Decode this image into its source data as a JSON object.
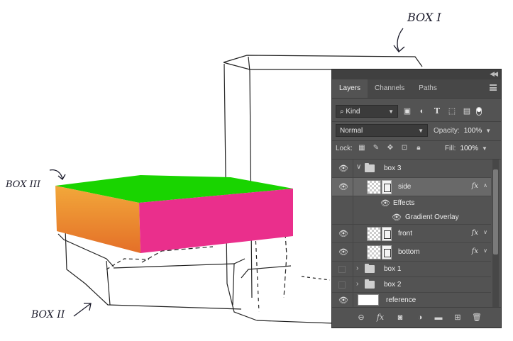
{
  "sketch": {
    "label_box_i": "BOX I",
    "label_box_ii": "BOX II",
    "label_box_iii": "BOX III",
    "colors": {
      "top": "#19d300",
      "left_top": "#f2a436",
      "left_bottom": "#e2702a",
      "front": "#ec2f8c"
    }
  },
  "panel": {
    "tabs": [
      {
        "label": "Layers",
        "active": true
      },
      {
        "label": "Channels"
      },
      {
        "label": "Paths"
      }
    ],
    "filter": {
      "kind_label": "Kind",
      "icons": [
        "image-filter-icon",
        "adjustment-filter-icon",
        "type-filter-icon",
        "shape-filter-icon",
        "smart-object-filter-icon"
      ]
    },
    "blend_mode": "Normal",
    "opacity_label": "Opacity:",
    "opacity_value": "100%",
    "lock_label": "Lock:",
    "fill_label": "Fill:",
    "fill_value": "100%",
    "layers": [
      {
        "name": "box 3",
        "type": "group",
        "expanded": true,
        "visible": true
      },
      {
        "name": "side",
        "type": "layer",
        "selected": true,
        "fx": "fx",
        "visible": true
      },
      {
        "name": "Effects",
        "type": "effects-header",
        "visible": true
      },
      {
        "name": "Gradient Overlay",
        "type": "effect",
        "visible": true
      },
      {
        "name": "front",
        "type": "layer",
        "fx": "fx",
        "visible": true
      },
      {
        "name": "bottom",
        "type": "layer",
        "fx": "fx",
        "visible": true
      },
      {
        "name": "box 1",
        "type": "group",
        "expanded": false,
        "visible": false
      },
      {
        "name": "box 2",
        "type": "group",
        "expanded": false,
        "visible": false
      },
      {
        "name": "reference",
        "type": "layer",
        "visible": true
      }
    ],
    "footer_icons": [
      "link-icon",
      "fx-icon",
      "mask-icon",
      "adjustment-icon",
      "new-group-icon",
      "new-layer-icon",
      "trash-icon"
    ],
    "fx_footer_label": "fx"
  }
}
